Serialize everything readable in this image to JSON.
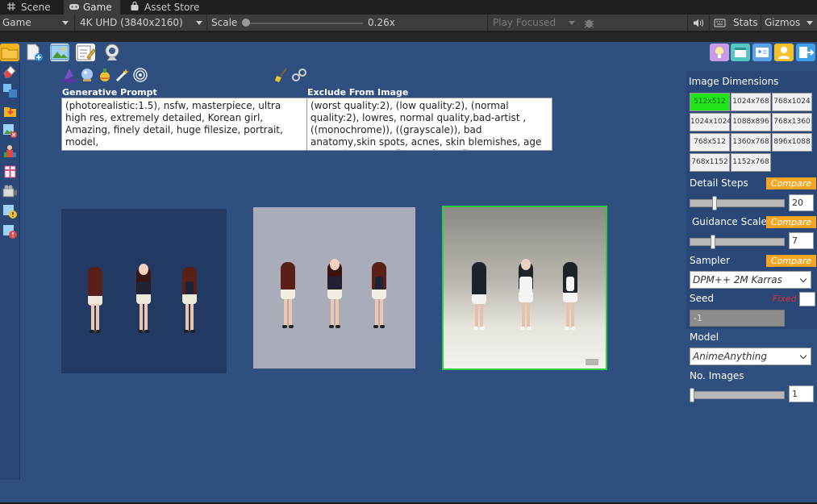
{
  "tabs": [
    {
      "label": "Scene",
      "icon": "grid-icon"
    },
    {
      "label": "Game",
      "icon": "gamepad-icon"
    },
    {
      "label": "Asset Store",
      "icon": "bag-icon"
    }
  ],
  "toolbar": {
    "display": "Game",
    "resolution": "4K UHD (3840x2160)",
    "scale_label": "Scale",
    "scale_value": "0.26x",
    "scale_fraction": 0.0,
    "play_mode": "Play Focused",
    "stats_label": "Stats",
    "gizmos_label": "Gizmos"
  },
  "prompt": {
    "generative_label": "Generative Prompt",
    "generative_text": "(photorealistic:1.5), nsfw, masterpiece, ultra high res, extremely detailed, Korean girl, Amazing, finely detail, huge filesize, portrait, model,",
    "exclude_label": "Exclude From Image",
    "exclude_text": "(worst quality:2), (low quality:2), (normal quality:2), lowres, normal quality,bad-artist ,((monochrome)), ((grayscale)),          bad anatomy,skin spots, acnes, skin blemishes, age spot, glans,extra fingers,fewer fingers, strange fingers, bad hand, bad anatomy,bad proportions"
  },
  "panel": {
    "dimensions_label": "Image Dimensions",
    "dimensions": [
      "512x512",
      "1024x768",
      "768x1024",
      "1024x1024",
      "1088x896",
      "768x1360",
      "768x512",
      "1360x768",
      "896x1088",
      "768x1152",
      "1152x768"
    ],
    "selected_dimension": "512x512",
    "detail_steps_label": "Detail Steps",
    "detail_steps_value": "20",
    "guidance_label": "Guidance Scale",
    "guidance_value": "7",
    "compare_label": "Compare",
    "sampler_label": "Sampler",
    "sampler_value": "DPM++ 2M  Karras",
    "seed_label": "Seed",
    "seed_fixed_label": "Fixed",
    "seed_value": "-1",
    "model_label": "Model",
    "model_value": "AnimeAnything",
    "num_images_label": "No. Images",
    "num_images_value": "1"
  },
  "colors": {
    "game_bg": "#2f4f80",
    "panel_bg": "#294877",
    "selected_dim": "#22e21a",
    "compare_btn": "#f4a623",
    "fixed_text": "#e0302e",
    "selected_frame": "#2ecc40"
  },
  "icons": {
    "top_left": [
      "folder-icon",
      "new-file-icon",
      "image-icon",
      "edit-icon",
      "webcam-icon"
    ],
    "top_right": [
      "lightbulb-icon",
      "window-icon",
      "id-card-icon",
      "user-icon",
      "exit-icon"
    ],
    "prompt_tools": [
      "wizard-hat-icon",
      "crystal-ball-icon",
      "potion-icon",
      "magic-wand-icon",
      "spiral-icon"
    ],
    "clear_tools": [
      "broom-icon",
      "handcuffs-icon"
    ],
    "left_bar": [
      "eraser-icon",
      "swap-icon",
      "download-icon",
      "delete-image-icon",
      "character-icon",
      "gift-icon",
      "camera-icon",
      "warning-icon",
      "error-icon"
    ]
  }
}
